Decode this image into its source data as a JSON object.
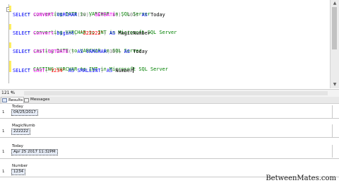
{
  "editor": {
    "lines": [
      {
        "comment": "-- converting DATE to VARCHAR in SQL Server"
      },
      {
        "kw1": "SELECT",
        "fn1": "CONVERT",
        "p1": "(",
        "kw2": "VARCHAR",
        "p2": "(20), ",
        "fn2": "GETDATE",
        "p3": "(), 101) ",
        "kw3": "AS",
        "p4": " Today"
      },
      {
        "comment": "-- converting VARCHAR to INT in Microsoft SQL Server"
      },
      {
        "kw1": "SELECT",
        "fn1": "Convert",
        "p1": "(",
        "kw2": "bigint",
        "p2": ", ",
        "str": "'222222'",
        "p3": ") ",
        "kw3": "AS",
        "p4": " MagicNumber"
      },
      {
        "comment": "-- casting DATE to VARCHAR in SQL Server"
      },
      {
        "kw1": "SELECT",
        "fn1": "CAST",
        "p1": "(",
        "fn2": "GETDATE",
        "p2": "() ",
        "kw2": "AS",
        "p3": " ",
        "kw3": "VARCHAR",
        "p4": "(30)) ",
        "kw4": "AS",
        "p5": " Today"
      },
      {
        "comment": "-- CASTING VARCHAR to INT in Microsoft SQL Server"
      },
      {
        "kw1": "SELECT",
        "fn1": "CAST",
        "p1": "(",
        "str": "'1234'",
        "p2": " ",
        "kw2": "AS",
        "p3": " ",
        "kw3": "SMALLINT",
        "p4": ") ",
        "kw4": "AS",
        "p5": " Number"
      }
    ]
  },
  "status": {
    "zoom": "121 %",
    "zoom_arrow": "▾"
  },
  "tabs": {
    "results": "Results",
    "messages": "Messages"
  },
  "grids": [
    {
      "row": "1",
      "header": "Today",
      "value": "04/25/2017"
    },
    {
      "row": "1",
      "header": "MagicNumb",
      "value": "222222"
    },
    {
      "row": "1",
      "header": "Today",
      "value": "Apr 25 2017 11:32PM"
    },
    {
      "row": "1",
      "header": "Number",
      "value": "1234"
    }
  ],
  "watermark": "BetweenMates.com"
}
